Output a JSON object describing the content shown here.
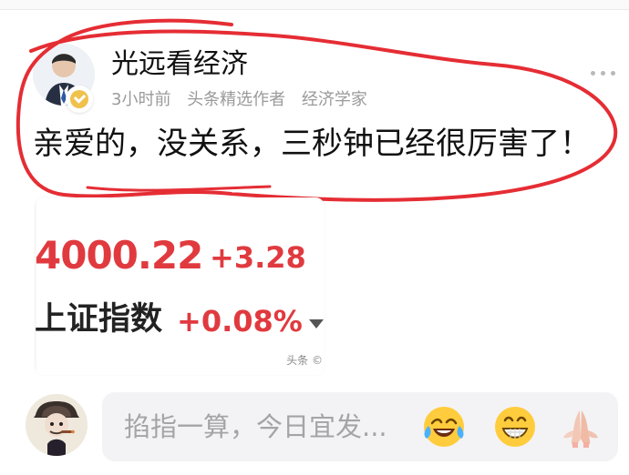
{
  "post": {
    "author": {
      "name": "光远看经济",
      "time": "3小时前",
      "badge_label": "头条精选作者",
      "role": "经济学家"
    },
    "text": "亲爱的，没关系，三秒钟已经很厉害了！",
    "market": {
      "value": "4000.22",
      "change": "+3.28",
      "name": "上证指数",
      "percent": "+0.08%",
      "source": "头条 ©"
    }
  },
  "comment_bar": {
    "placeholder": "掐指一算，今日宜发...",
    "emojis": [
      "laughing-emoji",
      "grinning-emoji",
      "praying-hands-emoji"
    ]
  },
  "colors": {
    "accent_red": "#e03a3f",
    "highlight_red": "#e52d34",
    "muted_gray": "#9a9a9a"
  }
}
